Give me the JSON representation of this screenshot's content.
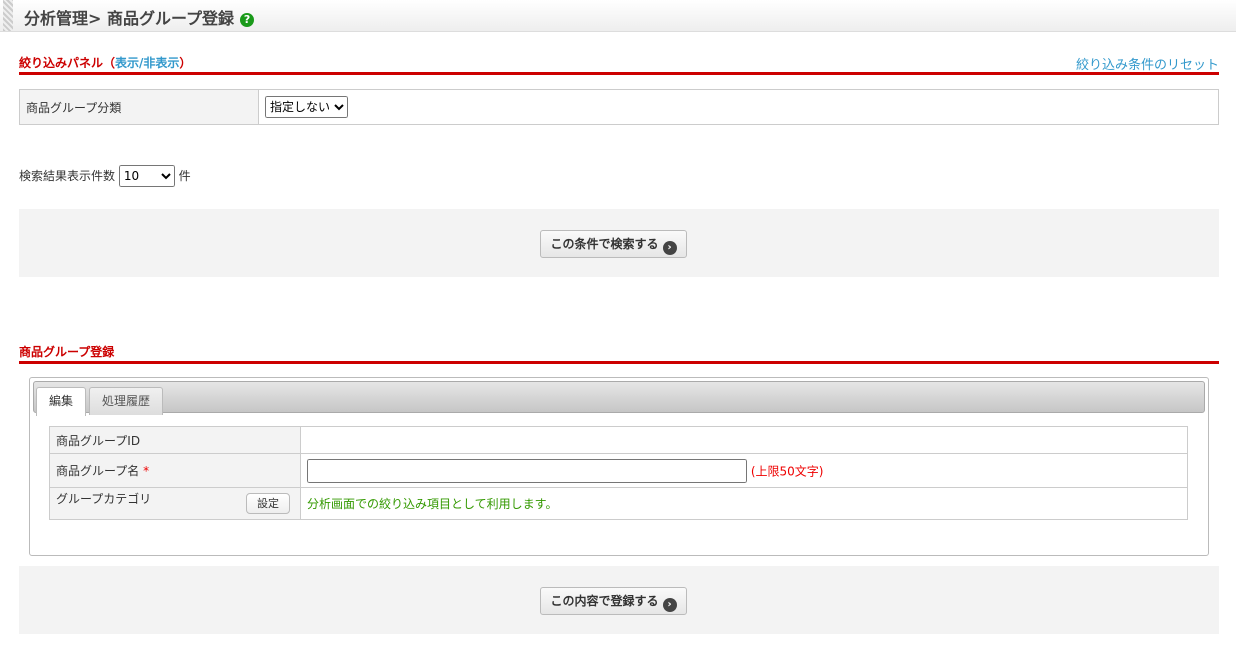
{
  "header": {
    "title": "分析管理> 商品グループ登録",
    "help": "?"
  },
  "filter": {
    "title": "絞り込みパネル（",
    "toggle": "表示/非表示",
    "close": "）",
    "reset": "絞り込み条件のリセット",
    "rows": [
      {
        "label": "商品グループ分類",
        "value": "指定しない"
      }
    ],
    "count_label": "検索結果表示件数",
    "count_value": "10",
    "count_unit": "件",
    "search_button": "この条件で検索する"
  },
  "register": {
    "title": "商品グループ登録",
    "tabs": [
      "編集",
      "処理履歴"
    ],
    "fields": {
      "id_label": "商品グループID",
      "name_label": "商品グループ名",
      "required": "*",
      "name_value": "",
      "name_limit": "(上限50文字)",
      "category_label": "グループカテゴリ",
      "category_button": "設定",
      "category_note": "分析画面での絞り込み項目として利用します。"
    },
    "submit_button": "この内容で登録する"
  },
  "colors": {
    "accent": "#cc0000",
    "link": "#3399cc",
    "note": "#339900"
  }
}
